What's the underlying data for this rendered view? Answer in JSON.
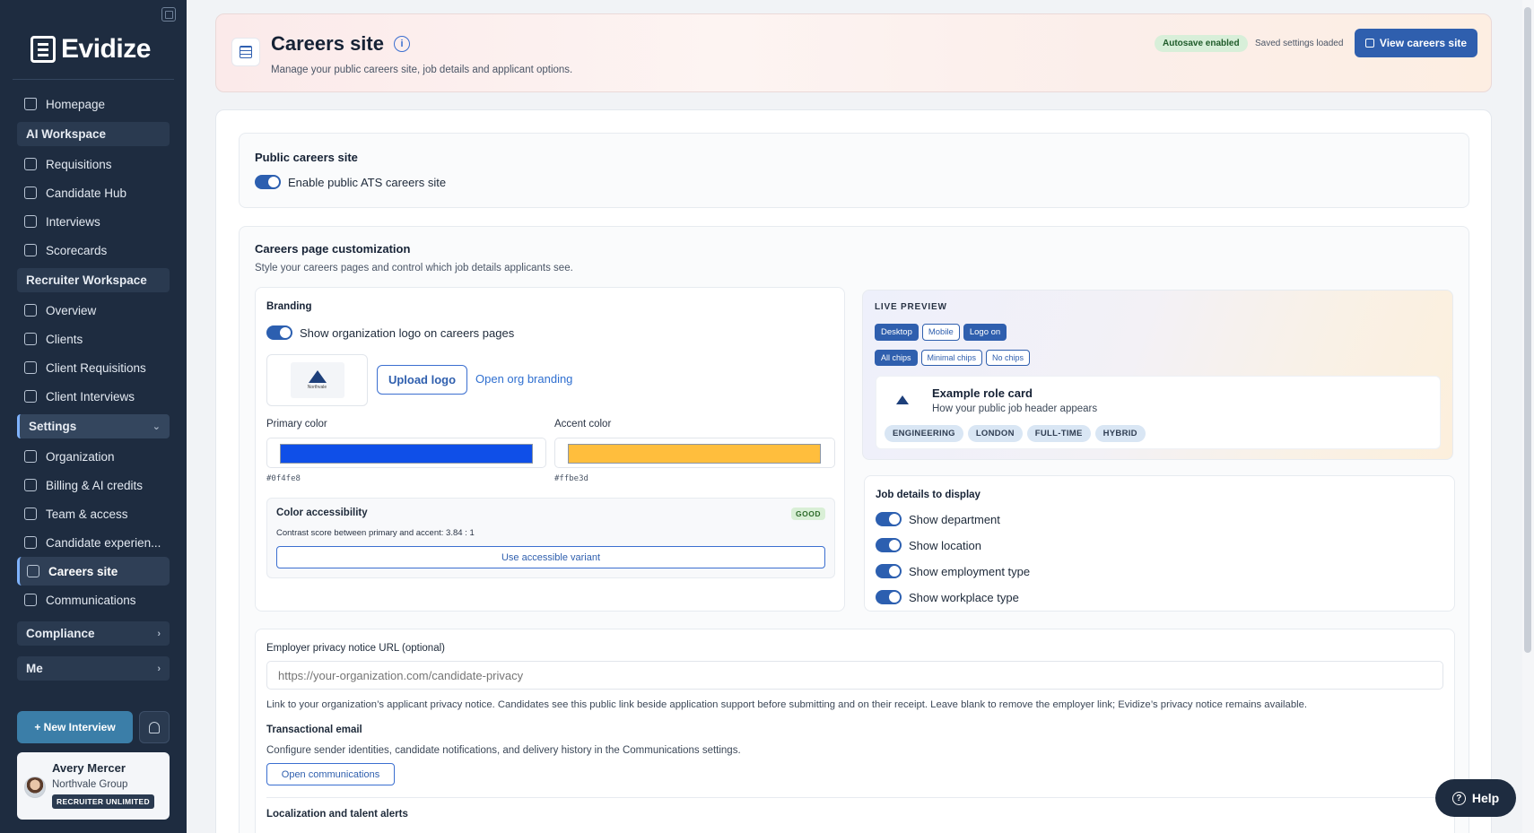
{
  "sidebar": {
    "brand": "Evidize",
    "items_top": [
      {
        "label": "Homepage",
        "icon": "home-icon"
      }
    ],
    "ai_workspace": {
      "label": "AI Workspace",
      "items": [
        {
          "label": "Requisitions",
          "icon": "briefcase-icon"
        },
        {
          "label": "Candidate Hub",
          "icon": "user-scan-icon"
        },
        {
          "label": "Interviews",
          "icon": "calendar-icon"
        },
        {
          "label": "Scorecards",
          "icon": "clipboard-icon"
        }
      ]
    },
    "recruiter_workspace": {
      "label": "Recruiter Workspace",
      "items": [
        {
          "label": "Overview",
          "icon": "grid-icon"
        },
        {
          "label": "Clients",
          "icon": "building-icon"
        },
        {
          "label": "Client Requisitions",
          "icon": "briefcase-icon"
        },
        {
          "label": "Client Interviews",
          "icon": "calendar-icon"
        }
      ]
    },
    "settings": {
      "label": "Settings",
      "items": [
        {
          "label": "Organization",
          "icon": "building-icon"
        },
        {
          "label": "Billing & AI credits",
          "icon": "credit-card-icon"
        },
        {
          "label": "Team & access",
          "icon": "users-icon"
        },
        {
          "label": "Candidate experien...",
          "icon": "user-settings-icon"
        },
        {
          "label": "Careers site",
          "icon": "table-icon",
          "active": true
        },
        {
          "label": "Communications",
          "icon": "mail-icon"
        }
      ]
    },
    "compliance": {
      "label": "Compliance"
    },
    "me": {
      "label": "Me"
    },
    "new_interview": "+ New Interview",
    "user": {
      "name": "Avery Mercer",
      "org": "Northvale Group",
      "plan": "RECRUITER UNLIMITED"
    }
  },
  "header": {
    "title": "Careers site",
    "subtitle": "Manage your public careers site, job details and applicant options.",
    "autosave": "Autosave enabled",
    "saved_status": "Saved settings loaded",
    "view_button": "View careers site"
  },
  "public_site": {
    "title": "Public careers site",
    "toggle_label": "Enable public ATS careers site",
    "enabled": true
  },
  "customization": {
    "title": "Careers page customization",
    "subtitle": "Style your careers pages and control which job details applicants see.",
    "branding": {
      "title": "Branding",
      "logo_toggle_label": "Show organization logo on careers pages",
      "logo_text": "Northvale",
      "upload_button": "Upload logo",
      "org_branding_link": "Open org branding",
      "primary_label": "Primary color",
      "primary_hex": "#0f4fe8",
      "accent_label": "Accent color",
      "accent_hex": "#ffbe3d",
      "accessibility": {
        "title": "Color accessibility",
        "status": "GOOD",
        "contrast_text": "Contrast score between primary and accent: 3.84 : 1",
        "variant_button": "Use accessible variant"
      }
    },
    "preview": {
      "title": "LIVE PREVIEW",
      "view_modes": [
        "Desktop",
        "Mobile",
        "Logo on"
      ],
      "chip_modes": [
        "All chips",
        "Minimal chips",
        "No chips"
      ],
      "role_title": "Example role card",
      "role_subtitle": "How your public job header appears",
      "tags": [
        "ENGINEERING",
        "LONDON",
        "FULL-TIME",
        "HYBRID"
      ]
    },
    "job_details": {
      "title": "Job details to display",
      "options": [
        "Show department",
        "Show location",
        "Show employment type",
        "Show workplace type"
      ]
    }
  },
  "privacy": {
    "label": "Employer privacy notice URL (optional)",
    "placeholder": "https://your-organization.com/candidate-privacy",
    "help": "Link to your organization’s applicant privacy notice. Candidates see this public link beside application support before submitting and on their receipt. Leave blank to remove the employer link; Evidize’s privacy notice remains available."
  },
  "transactional": {
    "title": "Transactional email",
    "text": "Configure sender identities, candidate notifications, and delivery history in the Communications settings.",
    "button": "Open communications"
  },
  "localization": {
    "title": "Localization and talent alerts"
  },
  "help_button": "Help",
  "colors": {
    "primary": "#0f4fe8",
    "accent": "#ffbe3d",
    "sidebar": "#1e2c40",
    "brand_blue": "#2f5fae"
  }
}
